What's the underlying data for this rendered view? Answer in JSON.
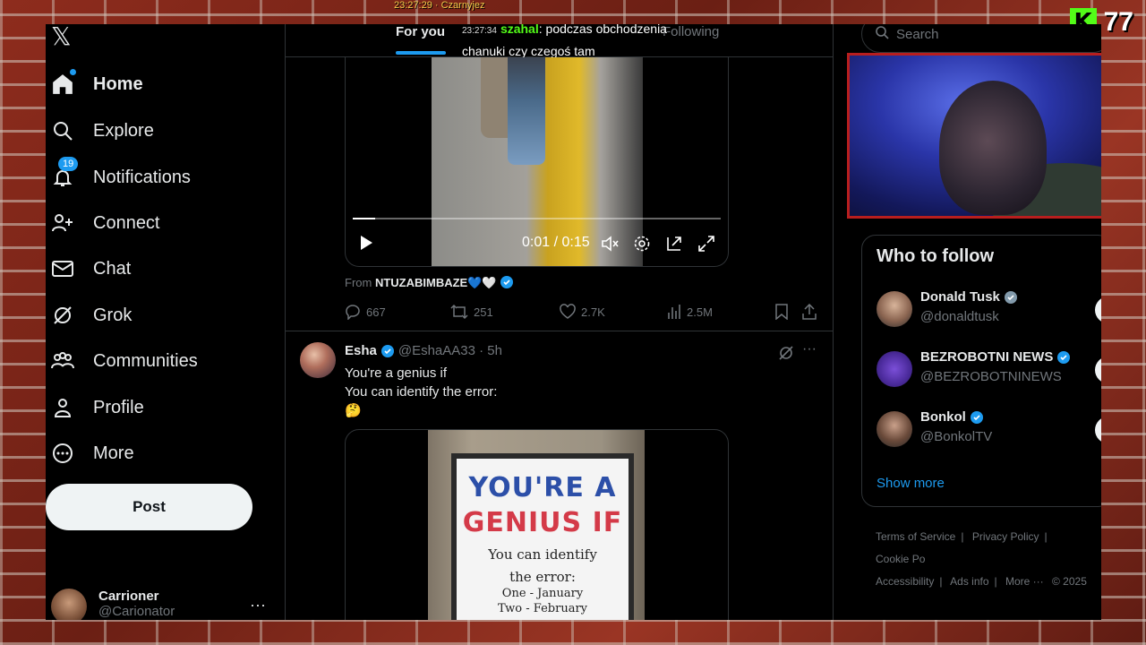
{
  "overlay": {
    "ticker": "23:27:29 · Czarnyjez",
    "kick_count": "77"
  },
  "chat": {
    "time": "23:27:34",
    "user": "szahal",
    "message": ": podczas obchodzenia chanuki czy czegoś tam"
  },
  "nav": {
    "items": [
      {
        "label": "Home"
      },
      {
        "label": "Explore"
      },
      {
        "label": "Notifications",
        "badge": "19"
      },
      {
        "label": "Connect"
      },
      {
        "label": "Chat"
      },
      {
        "label": "Grok"
      },
      {
        "label": "Communities"
      },
      {
        "label": "Profile"
      },
      {
        "label": "More"
      }
    ],
    "post_label": "Post",
    "account": {
      "name": "Carrioner",
      "handle": "@Carionator"
    }
  },
  "timeline": {
    "tabs": {
      "for_you": "For you",
      "following": "Following"
    },
    "video": {
      "time": "0:01 / 0:15",
      "progress": 0.06
    },
    "from": {
      "prefix": "From",
      "source": "NTUZABIMBAZE💙🤍"
    },
    "actions": {
      "replies": "667",
      "reposts": "251",
      "likes": "2.7K",
      "views": "2.5M"
    },
    "tweet2": {
      "name": "Esha",
      "handle": "@EshaAA33 · 5h",
      "line1": "You're a genius if",
      "line2": "You can identify the error:",
      "emoji": "🤔",
      "sign": {
        "line1": "YOU'RE A",
        "line2": "GENIUS IF",
        "line3": "You can identify",
        "line4": "the error:",
        "line5": "One - January",
        "line6": "Two - February"
      }
    }
  },
  "right": {
    "search_placeholder": "Search",
    "who_to_follow": {
      "title": "Who to follow",
      "accounts": [
        {
          "name": "Donald Tusk",
          "handle": "@donaldtusk"
        },
        {
          "name": "BEZROBOTNI NEWS",
          "handle": "@BEZROBOTNINEWS"
        },
        {
          "name": "Bonkol",
          "handle": "@BonkolTV"
        }
      ],
      "show_more": "Show more"
    },
    "footer": {
      "terms": "Terms of Service",
      "privacy": "Privacy Policy",
      "cookie": "Cookie Po",
      "accessibility": "Accessibility",
      "ads": "Ads info",
      "more": "More ···",
      "copyright": "© 2025"
    }
  },
  "colors": {
    "accent": "#1d9bf0",
    "kick_green": "#53fc18",
    "background": "#000000"
  }
}
